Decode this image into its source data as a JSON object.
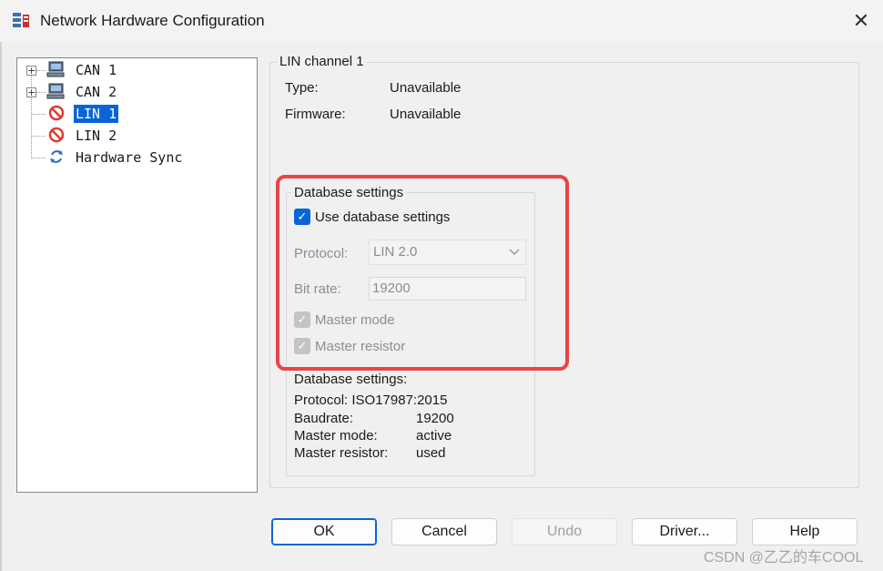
{
  "window": {
    "title": "Network Hardware Configuration",
    "close_glyph": "✕"
  },
  "tree": {
    "items": [
      {
        "label": "CAN 1",
        "icon": "computer-icon",
        "expandable": true
      },
      {
        "label": "CAN 2",
        "icon": "computer-icon",
        "expandable": true
      },
      {
        "label": "LIN 1",
        "icon": "unavailable-icon",
        "selected": true
      },
      {
        "label": "LIN 2",
        "icon": "unavailable-icon"
      },
      {
        "label": "Hardware Sync",
        "icon": "sync-icon"
      }
    ]
  },
  "channel": {
    "group_label": "LIN channel 1",
    "type_label": "Type:",
    "type_value": "Unavailable",
    "firmware_label": "Firmware:",
    "firmware_value": "Unavailable"
  },
  "db_settings": {
    "group_label": "Database settings",
    "use_db_label": "Use database settings",
    "use_db_checked": true,
    "protocol_label": "Protocol:",
    "protocol_value": "LIN 2.0",
    "bitrate_label": "Bit rate:",
    "bitrate_value": "19200",
    "master_mode_label": "Master mode",
    "master_resistor_label": "Master resistor"
  },
  "db_summary": {
    "heading": "Database settings:",
    "protocol_line": "Protocol: ISO17987:2015",
    "baudrate_label": "Baudrate:",
    "baudrate_value": "19200",
    "master_mode_label": "Master mode:",
    "master_mode_value": "active",
    "master_resistor_label": "Master resistor:",
    "master_resistor_value": "used"
  },
  "buttons": {
    "ok": "OK",
    "cancel": "Cancel",
    "undo": "Undo",
    "driver": "Driver...",
    "help": "Help"
  },
  "watermark": "CSDN @乙乙的车COOL",
  "colors": {
    "accent": "#0a64d6",
    "highlight_box": "#e84545"
  }
}
